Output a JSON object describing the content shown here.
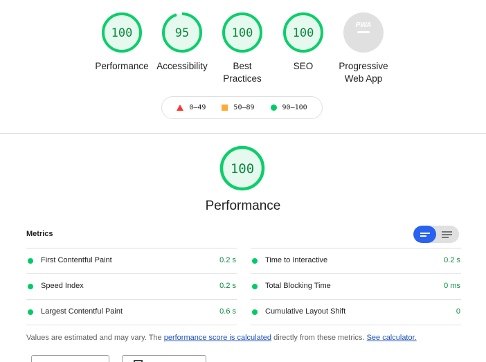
{
  "gauges": [
    {
      "score": "100",
      "label": "Performance",
      "fraction": 1.0
    },
    {
      "score": "95",
      "label": "Accessibility",
      "fraction": 0.95
    },
    {
      "score": "100",
      "label": "Best Practices",
      "fraction": 1.0
    },
    {
      "score": "100",
      "label": "SEO",
      "fraction": 1.0
    },
    {
      "score": "PWA",
      "label": "Progressive Web App",
      "fraction": 0
    }
  ],
  "legend": {
    "fail": "0–49",
    "average": "50–89",
    "pass": "90–100"
  },
  "performance": {
    "score": "100",
    "title": "Performance"
  },
  "metrics": {
    "header": "Metrics",
    "left": [
      {
        "name": "First Contentful Paint",
        "value": "0.2 s"
      },
      {
        "name": "Speed Index",
        "value": "0.2 s"
      },
      {
        "name": "Largest Contentful Paint",
        "value": "0.6 s"
      }
    ],
    "right": [
      {
        "name": "Time to Interactive",
        "value": "0.2 s"
      },
      {
        "name": "Total Blocking Time",
        "value": "0 ms"
      },
      {
        "name": "Cumulative Layout Shift",
        "value": "0"
      }
    ]
  },
  "footnote": {
    "prefix": "Values are estimated and may vary. The ",
    "link1": "performance score is calculated",
    "middle": " directly from these metrics. ",
    "link2": "See calculator."
  },
  "colors": {
    "pass": "#0cce6b",
    "pass_text": "#0a8a3f",
    "pass_bg": "#e6f9ee",
    "fail": "#ff3333",
    "average": "#ffaa33",
    "toggle_active": "#2a62f0"
  }
}
